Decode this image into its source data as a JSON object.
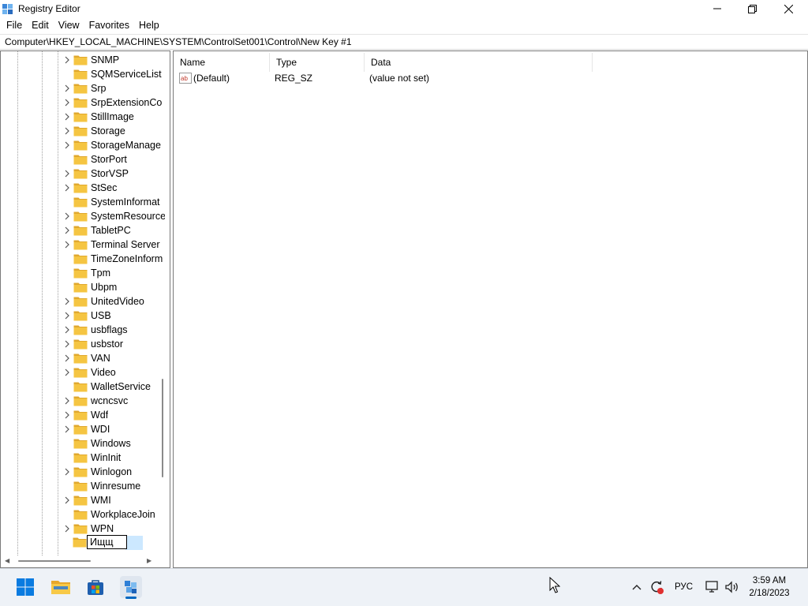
{
  "window": {
    "title": "Registry Editor",
    "minimize_icon": "minimize-icon",
    "maximize_icon": "restore-icon",
    "close_icon": "close-icon"
  },
  "menu": [
    "File",
    "Edit",
    "View",
    "Favorites",
    "Help"
  ],
  "address": "Computer\\HKEY_LOCAL_MACHINE\\SYSTEM\\ControlSet001\\Control\\New Key #1",
  "tree": {
    "nodes": [
      {
        "label": "SNMP",
        "expandable": true
      },
      {
        "label": "SQMServiceList",
        "expandable": false
      },
      {
        "label": "Srp",
        "expandable": true
      },
      {
        "label": "SrpExtensionCo",
        "expandable": true
      },
      {
        "label": "StillImage",
        "expandable": true
      },
      {
        "label": "Storage",
        "expandable": true
      },
      {
        "label": "StorageManage",
        "expandable": true
      },
      {
        "label": "StorPort",
        "expandable": false
      },
      {
        "label": "StorVSP",
        "expandable": true
      },
      {
        "label": "StSec",
        "expandable": true
      },
      {
        "label": "SystemInformat",
        "expandable": false
      },
      {
        "label": "SystemResource",
        "expandable": true
      },
      {
        "label": "TabletPC",
        "expandable": true
      },
      {
        "label": "Terminal Server",
        "expandable": true
      },
      {
        "label": "TimeZoneInform",
        "expandable": false
      },
      {
        "label": "Tpm",
        "expandable": false
      },
      {
        "label": "Ubpm",
        "expandable": false
      },
      {
        "label": "UnitedVideo",
        "expandable": true
      },
      {
        "label": "USB",
        "expandable": true
      },
      {
        "label": "usbflags",
        "expandable": true
      },
      {
        "label": "usbstor",
        "expandable": true
      },
      {
        "label": "VAN",
        "expandable": true
      },
      {
        "label": "Video",
        "expandable": true
      },
      {
        "label": "WalletService",
        "expandable": false
      },
      {
        "label": "wcncsvc",
        "expandable": true
      },
      {
        "label": "Wdf",
        "expandable": true
      },
      {
        "label": "WDI",
        "expandable": true
      },
      {
        "label": "Windows",
        "expandable": false
      },
      {
        "label": "WinInit",
        "expandable": false
      },
      {
        "label": "Winlogon",
        "expandable": true
      },
      {
        "label": "Winresume",
        "expandable": false
      },
      {
        "label": "WMI",
        "expandable": true
      },
      {
        "label": "WorkplaceJoin",
        "expandable": false
      },
      {
        "label": "WPN",
        "expandable": true
      }
    ],
    "rename_value": "Ищщ"
  },
  "list": {
    "columns": [
      "Name",
      "Type",
      "Data"
    ],
    "rows": [
      {
        "icon": "string-value-icon",
        "name": "(Default)",
        "type": "REG_SZ",
        "data": "(value not set)"
      }
    ]
  },
  "taskbar": {
    "icons": [
      "start-icon",
      "file-explorer-icon",
      "store-icon",
      "registry-editor-icon"
    ],
    "tray": {
      "language": "РУС",
      "time": "3:59 AM",
      "date": "2/18/2023"
    }
  },
  "colors": {
    "folder": "#f5c542",
    "selection": "#cce8ff",
    "taskbar": "#eef2f7",
    "accent": "#0067c0"
  }
}
